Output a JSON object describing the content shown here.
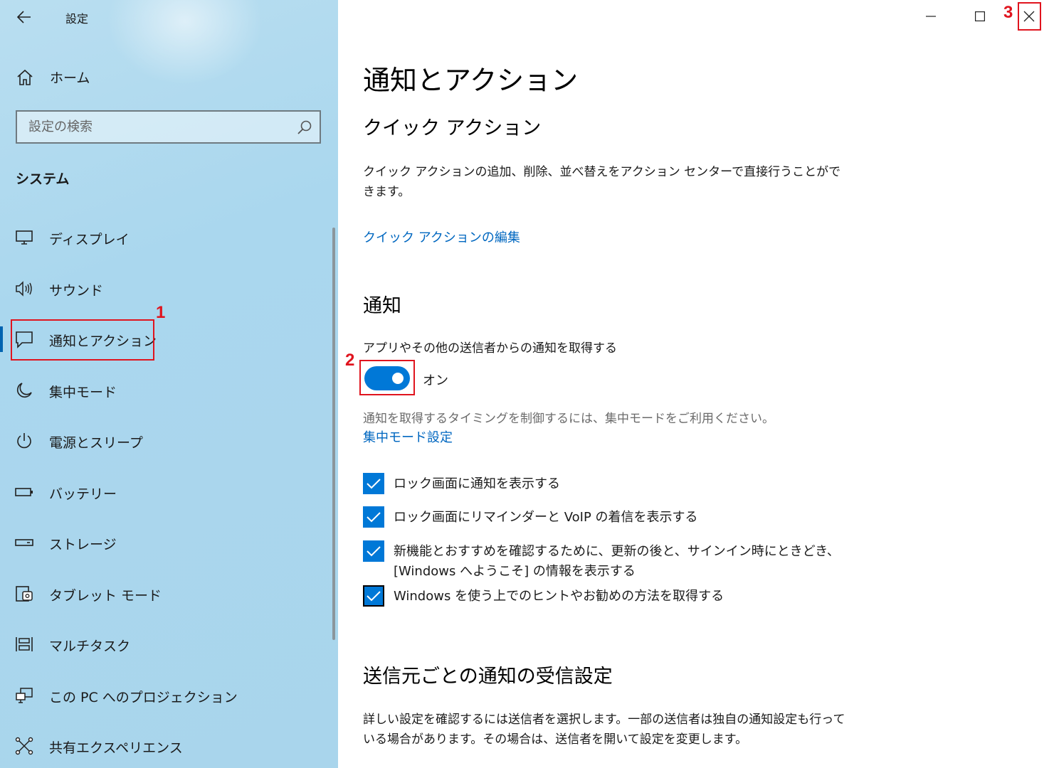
{
  "window": {
    "title": "設定",
    "back_icon": "back-arrow-icon",
    "controls": {
      "minimize_icon": "minimize-icon",
      "maximize_icon": "maximize-icon",
      "close_icon": "close-icon"
    }
  },
  "sidebar": {
    "home_label": "ホーム",
    "search_placeholder": "設定の検索",
    "section_title": "システム",
    "items": [
      {
        "label": "ディスプレイ",
        "icon": "display-icon",
        "active": false
      },
      {
        "label": "サウンド",
        "icon": "speaker-icon",
        "active": false
      },
      {
        "label": "通知とアクション",
        "icon": "notification-icon",
        "active": true
      },
      {
        "label": "集中モード",
        "icon": "moon-icon",
        "active": false
      },
      {
        "label": "電源とスリープ",
        "icon": "power-icon",
        "active": false
      },
      {
        "label": "バッテリー",
        "icon": "battery-icon",
        "active": false
      },
      {
        "label": "ストレージ",
        "icon": "storage-icon",
        "active": false
      },
      {
        "label": "タブレット モード",
        "icon": "tablet-mode-icon",
        "active": false
      },
      {
        "label": "マルチタスク",
        "icon": "multitask-icon",
        "active": false
      },
      {
        "label": "この PC へのプロジェクション",
        "icon": "projection-icon",
        "active": false
      },
      {
        "label": "共有エクスペリエンス",
        "icon": "shared-experience-icon",
        "active": false
      }
    ]
  },
  "main": {
    "page_title": "通知とアクション",
    "quick_actions": {
      "heading": "クイック アクション",
      "description": "クイック アクションの追加、削除、並べ替えをアクション センターで直接行うことができます。",
      "edit_link": "クイック アクションの編集"
    },
    "notifications": {
      "heading": "通知",
      "toggle_label": "アプリやその他の送信者からの通知を取得する",
      "toggle_state": "オン",
      "toggle_on": true,
      "hint": "通知を取得するタイミングを制御するには、集中モードをご利用ください。",
      "focus_link": "集中モード設定",
      "checkboxes": [
        {
          "label": "ロック画面に通知を表示する",
          "checked": true
        },
        {
          "label": "ロック画面にリマインダーと VoIP の着信を表示する",
          "checked": true
        },
        {
          "label": "新機能とおすすめを確認するために、更新の後と、サインイン時にときどき、",
          "label2": "[Windows へようこそ] の情報を表示する",
          "checked": true
        },
        {
          "label": "Windows を使う上でのヒントやお勧めの方法を取得する",
          "checked": true
        }
      ]
    },
    "per_sender": {
      "heading": "送信元ごとの通知の受信設定",
      "description": "詳しい設定を確認するには送信者を選択します。一部の送信者は独自の通知設定も行っている場合があります。その場合は、送信者を開いて設定を変更します。"
    }
  },
  "annotations": {
    "n1": "1",
    "n2": "2",
    "n3": "3",
    "color": "#e0141e"
  },
  "colors": {
    "accent": "#0078d7",
    "link": "#0067c0",
    "sidebar_bg": "#aad7ee"
  }
}
